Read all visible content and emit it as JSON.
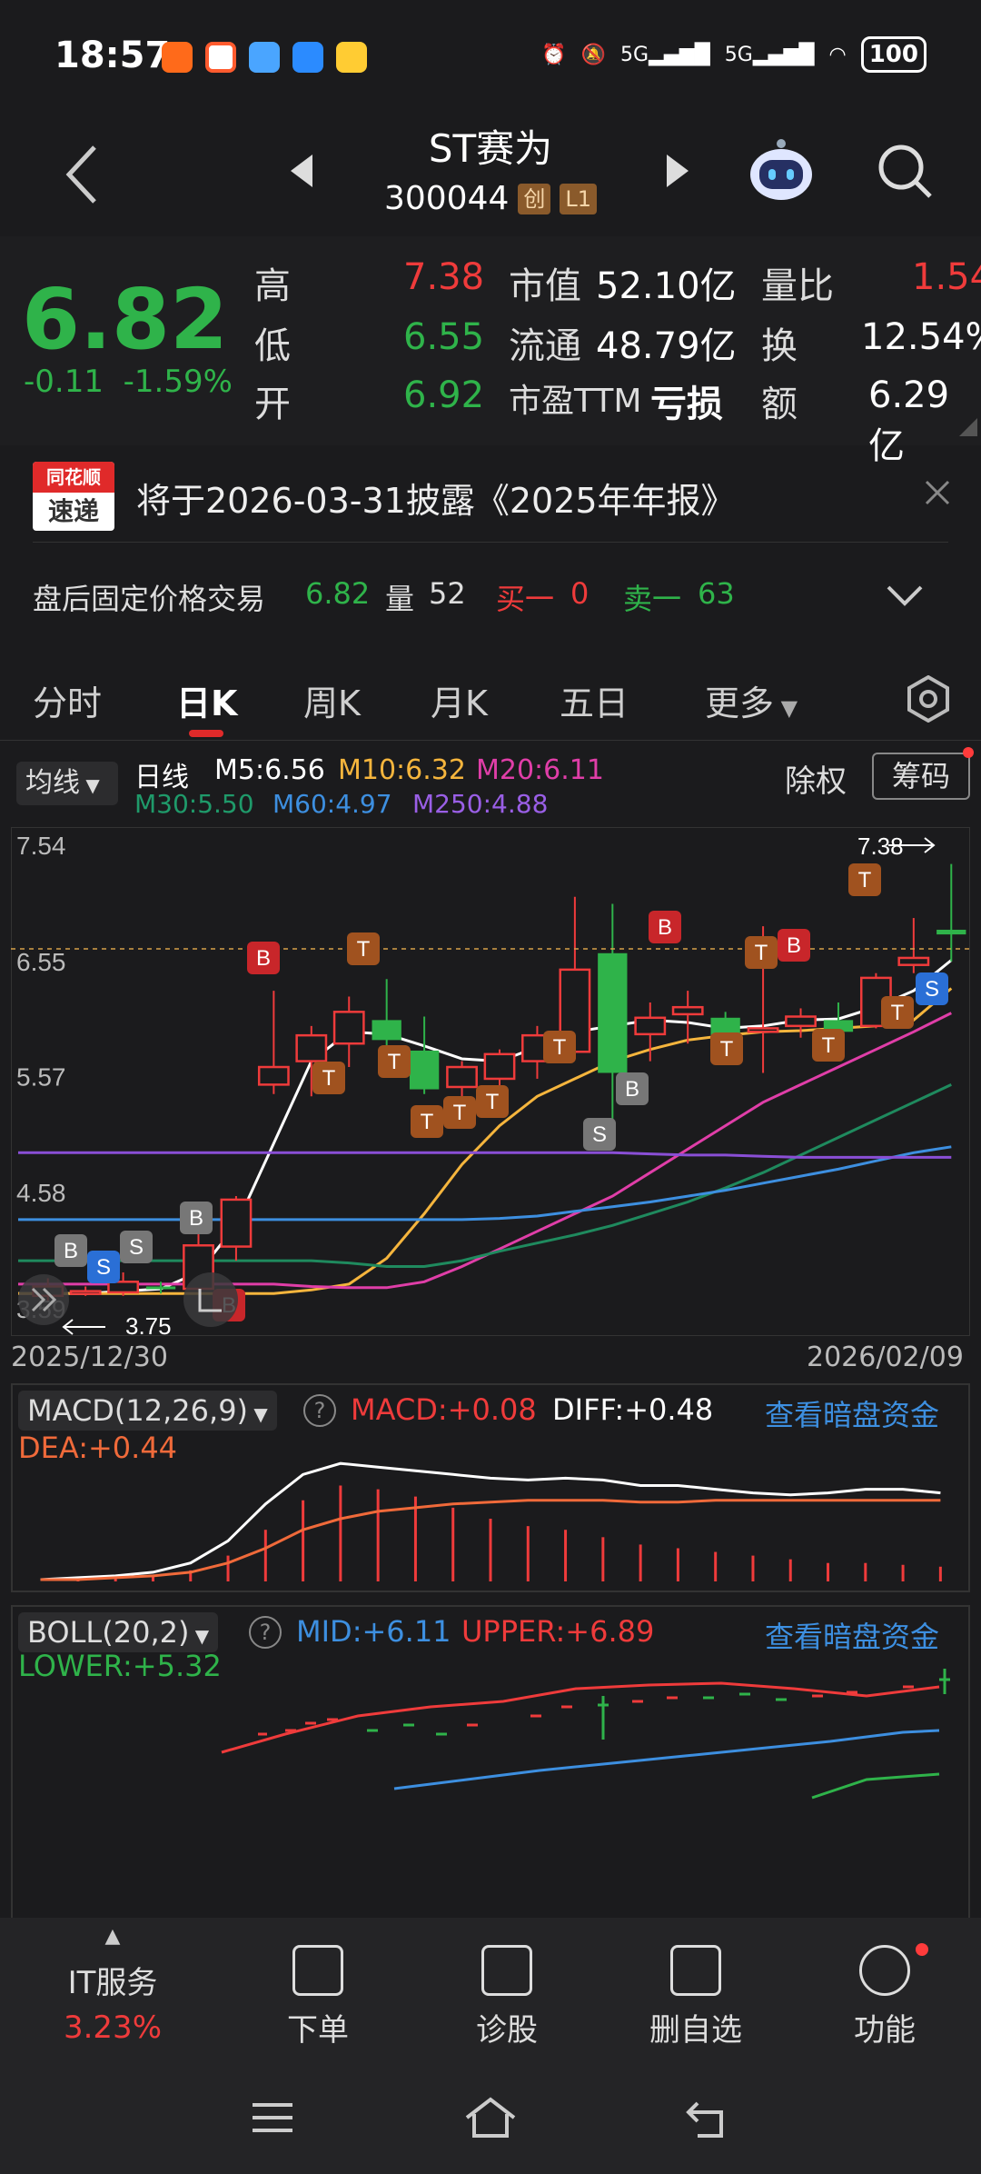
{
  "status_bar": {
    "time": "18:57",
    "network": "5G",
    "network2": "5G",
    "battery": "100"
  },
  "header": {
    "name": "ST赛为",
    "code": "300044",
    "tag1": "创",
    "tag2": "L1"
  },
  "quote": {
    "price": "6.82",
    "change": "-0.11",
    "change_pct": "-1.59%",
    "high_label": "高",
    "high": "7.38",
    "low_label": "低",
    "low": "6.55",
    "open_label": "开",
    "open": "6.92",
    "mktcap_label": "市值",
    "mktcap": "52.10亿",
    "float_label": "流通",
    "float": "48.79亿",
    "pe_label": "市盈TTM",
    "pe": "亏损",
    "volratio_label": "量比",
    "volratio": "1.54",
    "turnover_label": "换",
    "turnover": "12.54%",
    "amount_label": "额",
    "amount": "6.29亿"
  },
  "notice": {
    "badge_top": "同花顺",
    "badge_bottom": "速递",
    "text": "将于2026-03-31披露《2025年年报》"
  },
  "after_trade": {
    "label": "盘后固定价格交易",
    "price": "6.82",
    "vol_label": "量",
    "vol": "52",
    "buy_label": "买一",
    "buy": "0",
    "sell_label": "卖一",
    "sell": "63"
  },
  "tabs": [
    "分时",
    "日K",
    "周K",
    "月K",
    "五日",
    "更多"
  ],
  "indicator_bar": {
    "select": "均线",
    "period": "日线",
    "m5": "M5:6.56",
    "m10": "M10:6.32",
    "m20": "M20:6.11",
    "m30": "M30:5.50",
    "m60": "M60:4.97",
    "m250": "M250:4.88",
    "exright": "除权",
    "chips": "筹码"
  },
  "colors": {
    "up": "#ef3b3b",
    "down": "#2fb34a",
    "m5": "#ffffff",
    "m10": "#f5b53d",
    "m20": "#e03ea8",
    "m30": "#1f8a5e",
    "m60": "#3d8fe0",
    "m250": "#8a4fd6"
  },
  "kchart": {
    "y_ticks": [
      "7.54",
      "6.55",
      "5.57",
      "4.58",
      "3.59"
    ],
    "date_start": "2025/12/30",
    "date_end": "2026/02/09",
    "max_label": "7.38",
    "min_label": "3.75"
  },
  "chart_data": [
    {
      "type": "candlestick",
      "title": "日线",
      "ylim": [
        3.59,
        7.54
      ],
      "x_range": [
        "2025/12/30",
        "2026/02/09"
      ],
      "candles": [
        {
          "o": 3.7,
          "c": 3.78,
          "h": 3.85,
          "l": 3.65
        },
        {
          "o": 3.72,
          "c": 3.74,
          "h": 3.78,
          "l": 3.7
        },
        {
          "o": 3.73,
          "c": 3.82,
          "h": 3.9,
          "l": 3.7
        },
        {
          "o": 3.78,
          "c": 3.76,
          "h": 3.82,
          "l": 3.72
        },
        {
          "o": 3.76,
          "c": 4.13,
          "h": 4.3,
          "l": 3.75
        },
        {
          "o": 4.12,
          "c": 4.52,
          "h": 4.55,
          "l": 4.0
        },
        {
          "o": 5.5,
          "c": 5.65,
          "h": 6.3,
          "l": 5.42
        },
        {
          "o": 5.7,
          "c": 5.92,
          "h": 6.0,
          "l": 5.4
        },
        {
          "o": 5.85,
          "c": 6.12,
          "h": 6.25,
          "l": 5.65
        },
        {
          "o": 6.05,
          "c": 5.88,
          "h": 6.4,
          "l": 5.82
        },
        {
          "o": 5.79,
          "c": 5.46,
          "h": 6.08,
          "l": 5.42
        },
        {
          "o": 5.48,
          "c": 5.65,
          "h": 5.7,
          "l": 5.35
        },
        {
          "o": 5.55,
          "c": 5.76,
          "h": 5.8,
          "l": 5.4
        },
        {
          "o": 5.7,
          "c": 5.92,
          "h": 6.0,
          "l": 5.55
        },
        {
          "o": 5.78,
          "c": 6.48,
          "h": 7.1,
          "l": 5.72
        },
        {
          "o": 6.62,
          "c": 5.6,
          "h": 7.04,
          "l": 5.08
        },
        {
          "o": 5.93,
          "c": 6.07,
          "h": 6.2,
          "l": 5.7
        },
        {
          "o": 6.1,
          "c": 6.16,
          "h": 6.3,
          "l": 5.85
        },
        {
          "o": 6.07,
          "c": 5.92,
          "h": 6.12,
          "l": 5.9
        },
        {
          "o": 5.95,
          "c": 5.98,
          "h": 6.85,
          "l": 5.6
        },
        {
          "o": 6.0,
          "c": 6.08,
          "h": 6.15,
          "l": 5.9
        },
        {
          "o": 6.05,
          "c": 5.95,
          "h": 6.2,
          "l": 5.9
        },
        {
          "o": 6.0,
          "c": 6.41,
          "h": 6.45,
          "l": 5.98
        },
        {
          "o": 6.52,
          "c": 6.58,
          "h": 6.92,
          "l": 6.45
        },
        {
          "o": 6.82,
          "c": 6.78,
          "h": 7.38,
          "l": 6.55
        }
      ],
      "ma": {
        "M5": [
          3.72,
          3.74,
          3.76,
          3.9,
          4.3,
          5.0,
          5.7,
          5.95,
          5.93,
          5.83,
          5.72,
          5.7,
          5.82,
          5.95,
          6.0,
          6.05,
          6.03,
          5.98,
          6.0,
          6.05,
          6.06,
          6.16,
          6.3,
          6.56
        ],
        "M10": [
          3.72,
          3.72,
          3.75,
          3.8,
          4.02,
          4.4,
          4.82,
          5.15,
          5.4,
          5.55,
          5.7,
          5.8,
          5.88,
          5.92,
          5.95,
          5.96,
          5.98,
          6.0,
          6.05,
          6.32
        ],
        "M20": [
          3.8,
          3.78,
          3.77,
          3.77,
          3.82,
          3.95,
          4.1,
          4.25,
          4.4,
          4.55,
          4.75,
          4.95,
          5.15,
          5.35,
          5.5,
          5.65,
          5.8,
          5.95,
          6.11
        ],
        "M30": [
          4.0,
          3.98,
          3.95,
          3.95,
          4.0,
          4.08,
          4.15,
          4.22,
          4.3,
          4.4,
          4.5,
          4.62,
          4.75,
          4.9,
          5.05,
          5.2,
          5.35,
          5.5
        ],
        "M60": [
          4.35,
          4.35,
          4.36,
          4.38,
          4.42,
          4.46,
          4.5,
          4.55,
          4.6,
          4.66,
          4.72,
          4.78,
          4.85,
          4.92,
          4.97
        ],
        "M250": [
          4.92,
          4.91,
          4.9,
          4.9,
          4.89,
          4.88,
          4.88,
          4.88,
          4.88,
          4.88
        ]
      }
    },
    {
      "type": "bar",
      "title": "MACD(12,26,9)",
      "series": [
        {
          "name": "MACD",
          "values": [
            0.0,
            0.01,
            0.02,
            0.03,
            0.06,
            0.14,
            0.28,
            0.44,
            0.52,
            0.5,
            0.46,
            0.4,
            0.34,
            0.3,
            0.28,
            0.24,
            0.2,
            0.18,
            0.16,
            0.14,
            0.12,
            0.1,
            0.1,
            0.09,
            0.08
          ]
        }
      ],
      "lines": {
        "DIFF": [
          0.01,
          0.02,
          0.03,
          0.05,
          0.1,
          0.22,
          0.42,
          0.58,
          0.64,
          0.62,
          0.6,
          0.58,
          0.56,
          0.55,
          0.56,
          0.55,
          0.52,
          0.52,
          0.5,
          0.48,
          0.47,
          0.48,
          0.5,
          0.5,
          0.48
        ],
        "DEA": [
          0.01,
          0.01,
          0.02,
          0.03,
          0.05,
          0.1,
          0.18,
          0.28,
          0.34,
          0.38,
          0.4,
          0.42,
          0.43,
          0.44,
          0.44,
          0.44,
          0.43,
          0.43,
          0.44,
          0.44,
          0.44,
          0.44,
          0.44,
          0.44,
          0.44
        ]
      }
    }
  ],
  "macd_panel": {
    "select": "MACD(12,26,9)",
    "macd": "MACD:+0.08",
    "diff": "DIFF:+0.48",
    "dea": "DEA:+0.44",
    "link": "查看暗盘资金"
  },
  "boll_panel": {
    "select": "BOLL(20,2)",
    "mid": "MID:+6.11",
    "upper": "UPPER:+6.89",
    "lower": "LOWER:+5.32",
    "link": "查看暗盘资金"
  },
  "bottom_bar": {
    "sector": "IT服务",
    "sector_pct": "3.23%",
    "order": "下单",
    "diagnose": "诊股",
    "remove": "删自选",
    "functions": "功能"
  }
}
